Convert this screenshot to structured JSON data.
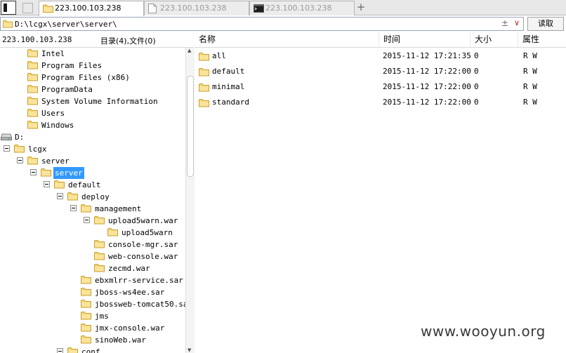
{
  "tabs": [
    {
      "label": "223.100.103.238",
      "icon": "folder-icon",
      "active": true
    },
    {
      "label": "223.100.103.238",
      "icon": "document-icon",
      "active": false
    },
    {
      "label": "223.100.103.238",
      "icon": "terminal-icon",
      "active": false
    }
  ],
  "tab_add_label": "+",
  "path": {
    "value": "D:\\lcgx\\server\\server\\",
    "clear_label": "±",
    "dropdown_label": "∨"
  },
  "read_button_label": "读取",
  "left_header": {
    "host": "223.100.103.238",
    "count": "目录(4),文件(0)"
  },
  "tree": [
    {
      "label": "Intel",
      "depth": 1,
      "type": "folder"
    },
    {
      "label": "Program Files",
      "depth": 1,
      "type": "folder"
    },
    {
      "label": "Program Files (x86)",
      "depth": 1,
      "type": "folder"
    },
    {
      "label": "ProgramData",
      "depth": 1,
      "type": "folder"
    },
    {
      "label": "System Volume Information",
      "depth": 1,
      "type": "folder"
    },
    {
      "label": "Users",
      "depth": 1,
      "type": "folder"
    },
    {
      "label": "Windows",
      "depth": 1,
      "type": "folder"
    },
    {
      "label": "D:",
      "depth": 0,
      "type": "drive"
    },
    {
      "label": "lcgx",
      "depth": 0,
      "type": "folder",
      "expanded": true
    },
    {
      "label": "server",
      "depth": 1,
      "type": "folder",
      "expanded": true
    },
    {
      "label": "server",
      "depth": 2,
      "type": "folder",
      "expanded": true,
      "selected": true
    },
    {
      "label": "default",
      "depth": 3,
      "type": "folder",
      "expanded": true
    },
    {
      "label": "deploy",
      "depth": 4,
      "type": "folder",
      "expanded": true
    },
    {
      "label": "management",
      "depth": 5,
      "type": "folder",
      "expanded": true
    },
    {
      "label": "upload5warn.war",
      "depth": 6,
      "type": "folder",
      "expanded": true
    },
    {
      "label": "upload5warn",
      "depth": 7,
      "type": "folder"
    },
    {
      "label": "console-mgr.sar",
      "depth": 6,
      "type": "folder"
    },
    {
      "label": "web-console.war",
      "depth": 6,
      "type": "folder"
    },
    {
      "label": "zecmd.war",
      "depth": 6,
      "type": "folder"
    },
    {
      "label": "ebxmlrr-service.sar",
      "depth": 5,
      "type": "folder"
    },
    {
      "label": "jboss-ws4ee.sar",
      "depth": 5,
      "type": "folder"
    },
    {
      "label": "jbossweb-tomcat50.sar",
      "depth": 5,
      "type": "folder"
    },
    {
      "label": "jms",
      "depth": 5,
      "type": "folder"
    },
    {
      "label": "jmx-console.war",
      "depth": 5,
      "type": "folder"
    },
    {
      "label": "sinoWeb.war",
      "depth": 5,
      "type": "folder"
    },
    {
      "label": "conf",
      "depth": 4,
      "type": "folder",
      "expanded": true
    }
  ],
  "columns": {
    "name": "名称",
    "time": "时间",
    "size": "大小",
    "attr": "属性"
  },
  "files": [
    {
      "name": "all",
      "time": "2015-11-12 17:21:35",
      "size": "0",
      "attr": "R W"
    },
    {
      "name": "default",
      "time": "2015-11-12 17:22:00",
      "size": "0",
      "attr": "R W"
    },
    {
      "name": "minimal",
      "time": "2015-11-12 17:22:00",
      "size": "0",
      "attr": "R W"
    },
    {
      "name": "standard",
      "time": "2015-11-12 17:22:00",
      "size": "0",
      "attr": "R W"
    }
  ],
  "watermark": "www.wooyun.org",
  "colors": {
    "folder": "#f5d46e",
    "folder_edge": "#c8a032",
    "selection": "#3399ff"
  }
}
